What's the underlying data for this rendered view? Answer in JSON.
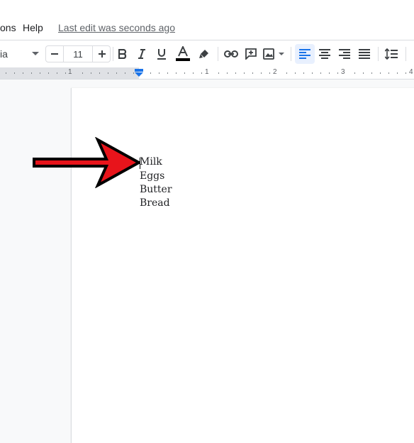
{
  "menubar": {
    "items": [
      "ons",
      "Help"
    ],
    "last_edit": "Last edit was seconds ago"
  },
  "toolbar": {
    "font_name": "ia",
    "font_size": "11",
    "icons": [
      "chevron-down-icon",
      "minus-icon",
      "plus-icon",
      "bold-icon",
      "italic-icon",
      "underline-icon",
      "text-color-icon",
      "highlight-icon",
      "link-icon",
      "add-comment-icon",
      "insert-image-icon",
      "align-left-icon",
      "align-center-icon",
      "align-right-icon",
      "justify-icon",
      "line-spacing-icon"
    ],
    "active_button": "align-left",
    "accent": "#1a73e8"
  },
  "ruler": {
    "numbers": [
      "1",
      "1",
      "1",
      "2",
      "3",
      "4"
    ]
  },
  "document": {
    "lines": [
      "Milk",
      "Eggs",
      "Butter",
      "Bread"
    ]
  },
  "annotation": {
    "arrow_color": "#e8141b"
  }
}
